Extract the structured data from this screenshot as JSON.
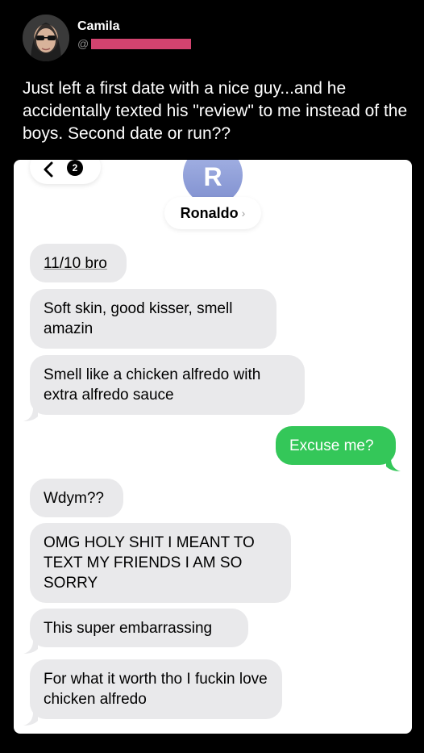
{
  "tweet": {
    "display_name": "Camila",
    "handle_prefix": "@",
    "text": "Just left a first date with a nice guy...and he accidentally texted his \"review\" to me instead of the boys. Second date or run??"
  },
  "conversation": {
    "back_badge": "2",
    "contact_initial": "R",
    "contact_name": "Ronaldo",
    "contact_chevron": "›",
    "messages": [
      {
        "from": "them",
        "text": "11/10 bro"
      },
      {
        "from": "them",
        "text": "Soft skin, good kisser, smell amazin"
      },
      {
        "from": "them",
        "text": "Smell like a chicken alfredo with extra alfredo sauce"
      },
      {
        "from": "me",
        "text": "Excuse me?"
      },
      {
        "from": "them",
        "text": "Wdym??"
      },
      {
        "from": "them",
        "text": "OMG HOLY SHIT I MEANT TO TEXT MY FRIENDS I AM SO SORRY"
      },
      {
        "from": "them",
        "text": "This super embarrassing"
      },
      {
        "from": "them",
        "text": "For what it worth tho I fuckin love chicken alfredo"
      }
    ]
  },
  "colors": {
    "received_bubble": "#e9e9eb",
    "sent_bubble": "#34c759",
    "redaction": "#d2436f",
    "contact_avatar": "#8f9fd9"
  },
  "icons": {
    "back": "chevron-left-icon",
    "contact_disclosure": "chevron-right-icon"
  }
}
